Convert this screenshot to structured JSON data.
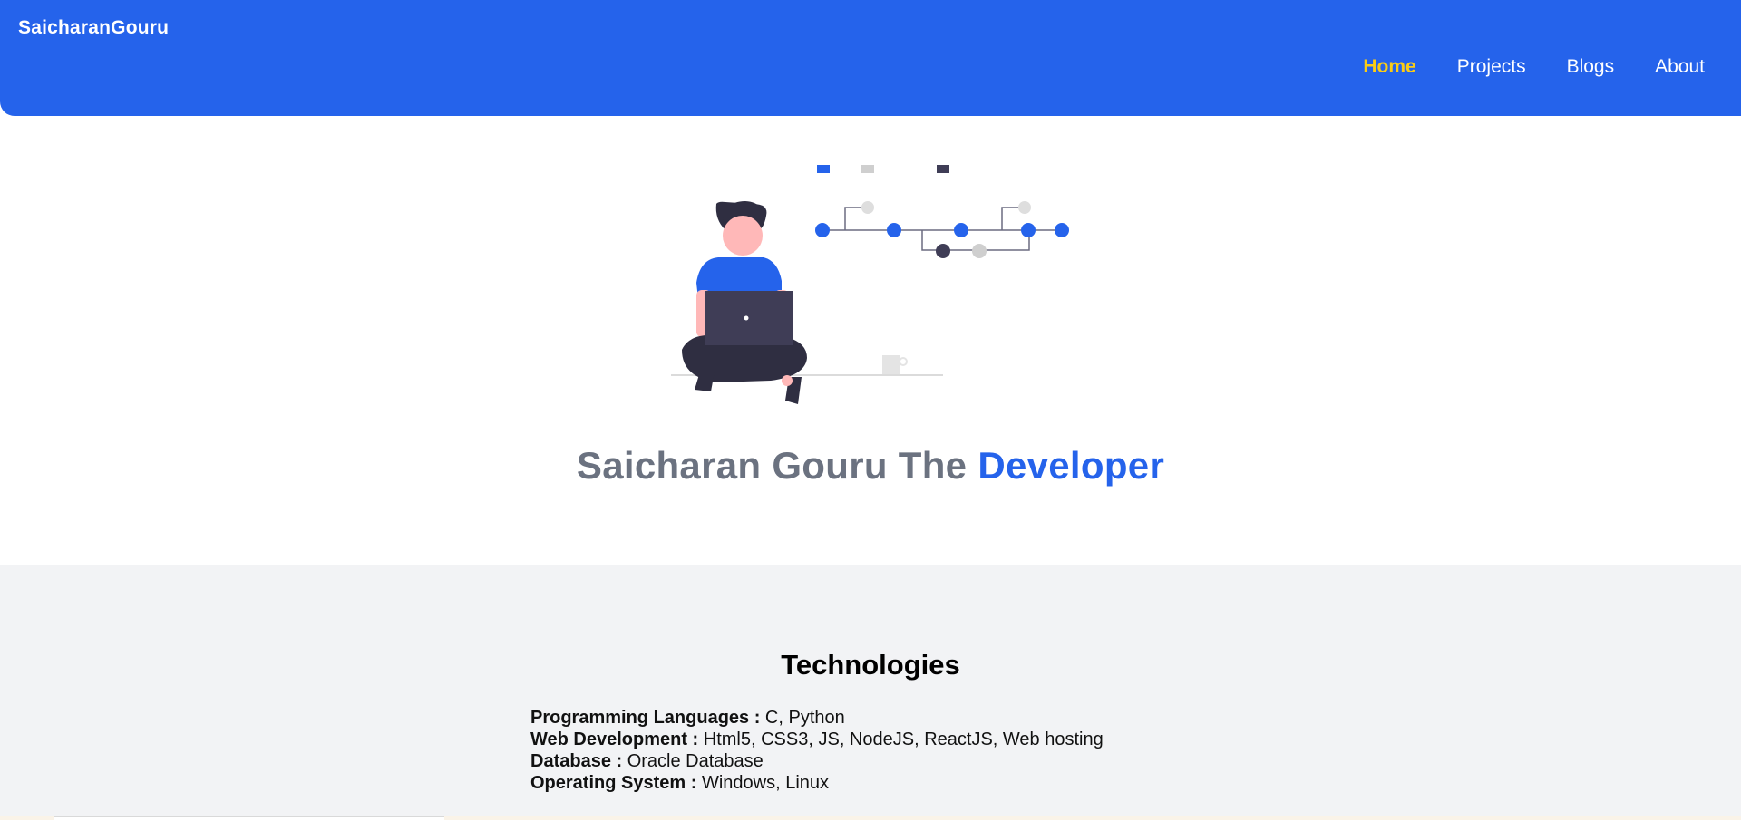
{
  "header": {
    "brand": "SaicharanGouru",
    "nav": [
      {
        "label": "Home",
        "active": true
      },
      {
        "label": "Projects",
        "active": false
      },
      {
        "label": "Blogs",
        "active": false
      },
      {
        "label": "About",
        "active": false
      }
    ]
  },
  "hero": {
    "title_main": "Saicharan Gouru The ",
    "title_accent": "Developer",
    "illustration": "developer-with-laptop-illustration"
  },
  "technologies": {
    "title": "Technologies",
    "rows": [
      {
        "key": "Programming Languages :",
        "value": " C, Python"
      },
      {
        "key": "Web Development :",
        "value": " Html5, CSS3, JS, NodeJS, ReactJS, Web hosting"
      },
      {
        "key": "Database :",
        "value": " Oracle Database"
      },
      {
        "key": "Operating System :",
        "value": " Windows, Linux"
      }
    ]
  },
  "colors": {
    "primary": "#2563eb",
    "nav_active": "#facc15",
    "title_gray": "#6b7280",
    "section_bg": "#f2f3f5"
  }
}
